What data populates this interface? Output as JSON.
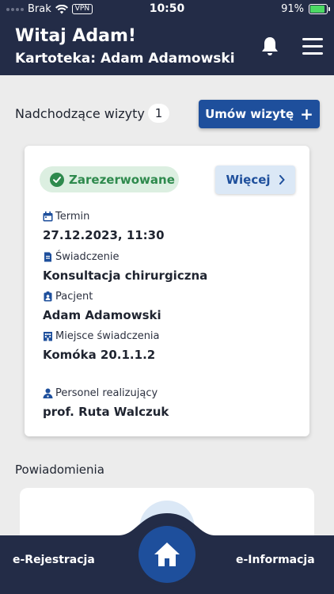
{
  "status_bar": {
    "carrier": "Brak",
    "vpn": "VPN",
    "time": "10:50",
    "battery": "91%",
    "battery_level": 0.91
  },
  "header": {
    "greeting": "Witaj Adam!",
    "record": "Kartoteka: Adam Adamowski",
    "bell_icon": "bell-icon",
    "menu_icon": "hamburger-menu-icon"
  },
  "upcoming": {
    "title": "Nadchodzące wizyty",
    "count": "1",
    "book_button": "Umów wizytę",
    "book_button_icon": "plus-icon"
  },
  "visit": {
    "status": "Zarezerwowane",
    "more_button": "Więcej",
    "fields": [
      {
        "label": "Termin",
        "value": "27.12.2023, 11:30",
        "icon": "calendar-icon"
      },
      {
        "label": "Świadczenie",
        "value": "Konsultacja chirurgiczna",
        "icon": "document-icon"
      },
      {
        "label": "Pacjent",
        "value": "Adam Adamowski",
        "icon": "patient-badge-icon"
      },
      {
        "label": "Miejsce świadczenia",
        "value": "Komóka 20.1.1.2",
        "icon": "building-icon"
      },
      {
        "label": "Personel realizujący",
        "value": "prof. Ruta Walczuk",
        "icon": "doctor-icon"
      }
    ]
  },
  "notifications": {
    "title": "Powiadomienia"
  },
  "bottom_nav": {
    "left": "e-Rejestracja",
    "right": "e-Informacja",
    "home_icon": "home-icon"
  },
  "colors": {
    "navy": "#232c47",
    "accent_blue": "#1e4f9c",
    "success_green": "#2e8a4d",
    "success_bg": "#dcefe1",
    "light_blue": "#dbe8f6",
    "page_bg": "#ececec"
  }
}
